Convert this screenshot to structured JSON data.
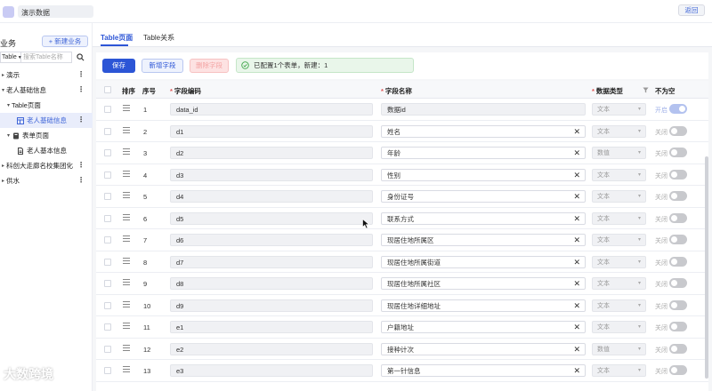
{
  "header": {
    "app_title": "演示数据",
    "back_label": "返回"
  },
  "sidebar": {
    "heading": "业务",
    "new_button": "+ 新建业务",
    "search_type": "Table",
    "search_placeholder": "搜索Table名称",
    "tree": [
      {
        "label": "演示",
        "level": 0,
        "caret": "▸",
        "icon": "none",
        "more": true
      },
      {
        "label": "老人基础信息",
        "level": 0,
        "caret": "▾",
        "icon": "none",
        "more": true
      },
      {
        "label": "Table页面",
        "level": 1,
        "caret": "▾",
        "icon": "none",
        "more": false
      },
      {
        "label": "老人基础信息",
        "level": 2,
        "caret": "",
        "icon": "table-icon",
        "more": true,
        "selected": true
      },
      {
        "label": "表单页面",
        "level": 1,
        "caret": "▾",
        "icon": "form-icon",
        "more": false
      },
      {
        "label": "老人基本信息",
        "level": 2,
        "caret": "",
        "icon": "doc-icon",
        "more": false
      },
      {
        "label": "科创大走廊名校集团化",
        "level": 0,
        "caret": "▸",
        "icon": "none",
        "more": true
      },
      {
        "label": "供水",
        "level": 0,
        "caret": "▸",
        "icon": "none",
        "more": true
      }
    ]
  },
  "tabs": [
    {
      "label": "Table页面",
      "active": true
    },
    {
      "label": "Table关系",
      "active": false
    }
  ],
  "toolbar": {
    "save_label": "保存",
    "add_label": "新增字段",
    "delete_label": "删除字段",
    "notice": "已配置1个表单，新建：1"
  },
  "table": {
    "headers": {
      "sort": "排序",
      "index": "序号",
      "code": "字段编码",
      "name": "字段名称",
      "type": "数据类型",
      "required": "不为空"
    },
    "rows": [
      {
        "index": "1",
        "code": "data_id",
        "name": "数据id",
        "type": "文本",
        "switch_label": "开启",
        "on": true,
        "name_disabled": true
      },
      {
        "index": "2",
        "code": "d1",
        "name": "姓名",
        "type": "文本",
        "switch_label": "关闭",
        "on": false
      },
      {
        "index": "3",
        "code": "d2",
        "name": "年龄",
        "type": "数值",
        "switch_label": "关闭",
        "on": false
      },
      {
        "index": "4",
        "code": "d3",
        "name": "性别",
        "type": "文本",
        "switch_label": "关闭",
        "on": false
      },
      {
        "index": "5",
        "code": "d4",
        "name": "身份证号",
        "type": "文本",
        "switch_label": "关闭",
        "on": false
      },
      {
        "index": "6",
        "code": "d5",
        "name": "联系方式",
        "type": "文本",
        "switch_label": "关闭",
        "on": false
      },
      {
        "index": "7",
        "code": "d6",
        "name": "现居住地所属区",
        "type": "文本",
        "switch_label": "关闭",
        "on": false
      },
      {
        "index": "8",
        "code": "d7",
        "name": "现居住地所属街道",
        "type": "文本",
        "switch_label": "关闭",
        "on": false
      },
      {
        "index": "9",
        "code": "d8",
        "name": "现居住地所属社区",
        "type": "文本",
        "switch_label": "关闭",
        "on": false
      },
      {
        "index": "10",
        "code": "d9",
        "name": "现居住地详细地址",
        "type": "文本",
        "switch_label": "关闭",
        "on": false
      },
      {
        "index": "11",
        "code": "e1",
        "name": "户籍地址",
        "type": "文本",
        "switch_label": "关闭",
        "on": false
      },
      {
        "index": "12",
        "code": "e2",
        "name": "接种计次",
        "type": "数值",
        "switch_label": "关闭",
        "on": false
      },
      {
        "index": "13",
        "code": "e3",
        "name": "第一针信息",
        "type": "文本",
        "switch_label": "关闭",
        "on": false
      }
    ]
  },
  "watermark": "大数跨境",
  "colors": {
    "primary": "#2c55d6",
    "success_bg": "#e9f6ea",
    "danger_bg": "#fde2e2"
  }
}
